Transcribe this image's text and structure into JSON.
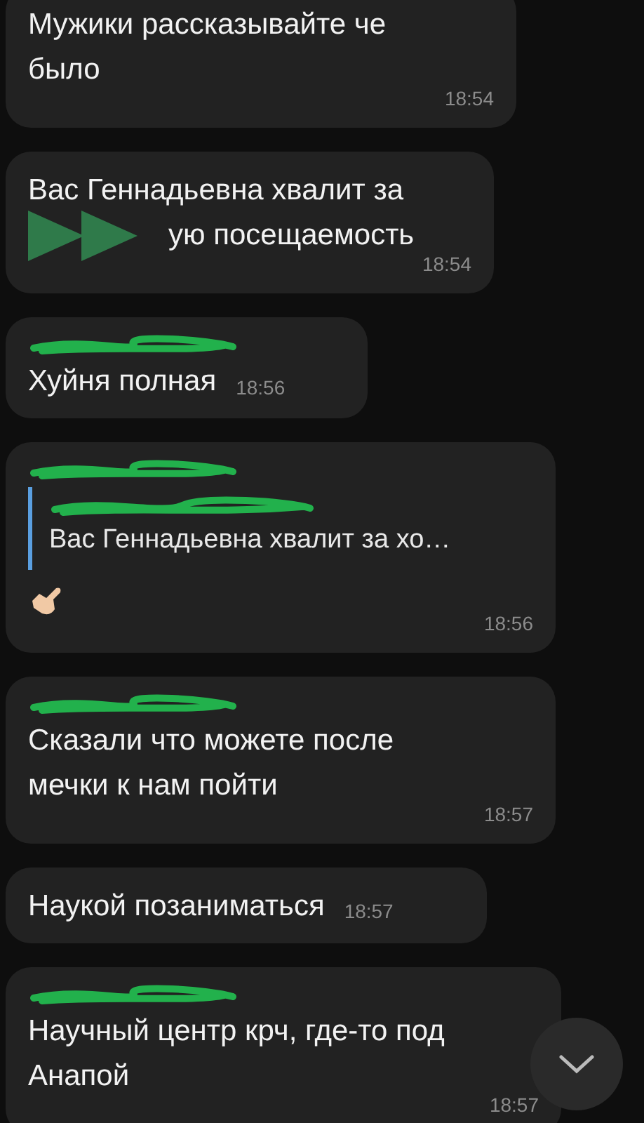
{
  "messages": [
    {
      "kind": "text",
      "sender_hidden": false,
      "lines": [
        "Мужики рассказывайте че",
        "было"
      ],
      "time": "18:54"
    },
    {
      "kind": "covered",
      "sender_hidden": false,
      "lines": [
        "Вас Геннадьевна хвалит за",
        "ую посещаемость"
      ],
      "time": "18:54"
    },
    {
      "kind": "text",
      "sender_hidden": true,
      "lines": [
        "Хуйня полная"
      ],
      "time": "18:56"
    },
    {
      "kind": "reply",
      "sender_hidden": true,
      "quote_sender_hidden": true,
      "quote": "Вас Геннадьевна хвалит за хо…",
      "time": "18:56"
    },
    {
      "kind": "text",
      "sender_hidden": true,
      "lines": [
        "Сказали что можете после",
        "мечки к нам пойти"
      ],
      "time": "18:57"
    },
    {
      "kind": "text",
      "sender_hidden": false,
      "lines": [
        "Наукой позаниматься"
      ],
      "time": "18:57"
    },
    {
      "kind": "text",
      "sender_hidden": true,
      "lines": [
        "Научный центр крч, где-то под",
        "Анапой"
      ],
      "time": "18:57"
    }
  ]
}
